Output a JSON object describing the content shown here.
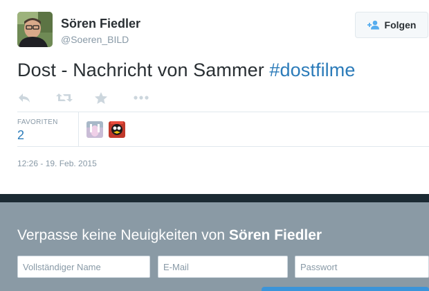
{
  "user": {
    "name": "Sören Fiedler",
    "handle": "@Soeren_BILD"
  },
  "follow_button": {
    "label": "Folgen",
    "icon": "follow-user-icon"
  },
  "tweet": {
    "text": "Dost - Nachricht von Sammer",
    "hashtag": "#dostfilme"
  },
  "actions": [
    {
      "name": "reply",
      "icon": "reply-icon"
    },
    {
      "name": "retweet",
      "icon": "retweet-icon"
    },
    {
      "name": "favorite",
      "icon": "star-icon"
    },
    {
      "name": "more",
      "icon": "more-icon"
    }
  ],
  "stats": {
    "favorites_label": "FAVORITEN",
    "favorites_count": "2"
  },
  "timestamp": "12:26 - 19. Feb. 2015",
  "signup": {
    "title_prefix": "Verpasse keine Neuigkeiten von",
    "title_name": "Sören Fiedler",
    "fields": {
      "name_placeholder": "Vollständiger Name",
      "email_placeholder": "E-Mail",
      "password_placeholder": "Passwort"
    }
  },
  "colors": {
    "link": "#2b7bb9",
    "muted": "#8899a6",
    "signup_bg": "#8a9aa5",
    "signup_band": "#1b2a33"
  }
}
